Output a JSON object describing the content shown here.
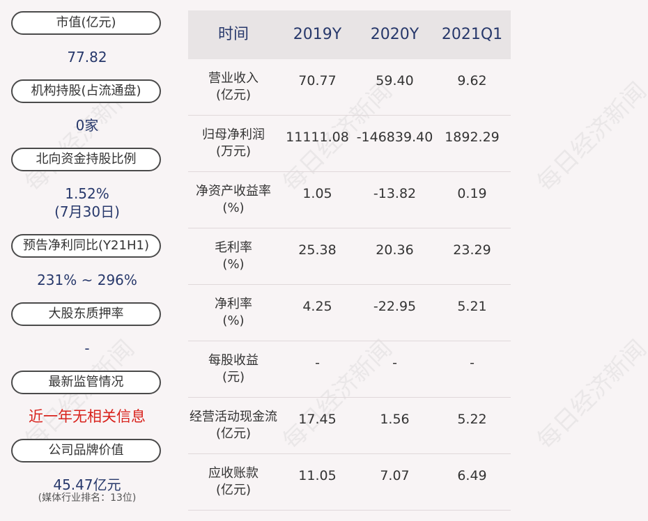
{
  "left_panel": {
    "items": [
      {
        "label": "市值(亿元)",
        "value": "77.82"
      },
      {
        "label": "机构持股(占流通盘)",
        "value": "0家"
      },
      {
        "label": "北向资金持股比例",
        "value": "1.52%",
        "value2": "(7月30日)"
      },
      {
        "label": "预告净利同比(Y21H1)",
        "value": "231% ~ 296%"
      },
      {
        "label": "大股东质押率",
        "value": "-"
      },
      {
        "label": "最新监管情况",
        "value": "近一年无相关信息"
      },
      {
        "label": "公司品牌价值",
        "value": "45.47亿元",
        "value2": "(媒体行业排名：13位)"
      }
    ]
  },
  "table": {
    "headers": [
      "时间",
      "2019Y",
      "2020Y",
      "2021Q1"
    ],
    "rows": [
      {
        "label1": "营业收入",
        "label2": "(亿元)",
        "values": [
          "70.77",
          "59.40",
          "9.62"
        ]
      },
      {
        "label1": "归母净利润",
        "label2": "(万元)",
        "values": [
          "11111.08",
          "-146839.40",
          "1892.29"
        ]
      },
      {
        "label1": "净资产收益率",
        "label2": "(%)",
        "values": [
          "1.05",
          "-13.82",
          "0.19"
        ]
      },
      {
        "label1": "毛利率",
        "label2": "(%)",
        "values": [
          "25.38",
          "20.36",
          "23.29"
        ]
      },
      {
        "label1": "净利率",
        "label2": "(%)",
        "values": [
          "4.25",
          "-22.95",
          "5.21"
        ]
      },
      {
        "label1": "每股收益",
        "label2": "(元)",
        "values": [
          "-",
          "-",
          "-"
        ]
      },
      {
        "label1": "经营活动现金流",
        "label2": "(亿元)",
        "values": [
          "17.45",
          "1.56",
          "5.22"
        ]
      },
      {
        "label1": "应收账款",
        "label2": "(亿元)",
        "values": [
          "11.05",
          "7.07",
          "6.49"
        ]
      }
    ]
  },
  "watermark": "每日经济新闻",
  "colors": {
    "value_blue": "#27386b",
    "alert_red": "#d8221c",
    "header_bg": "#e8e4e5",
    "page_bg": "#f8f4f5"
  }
}
